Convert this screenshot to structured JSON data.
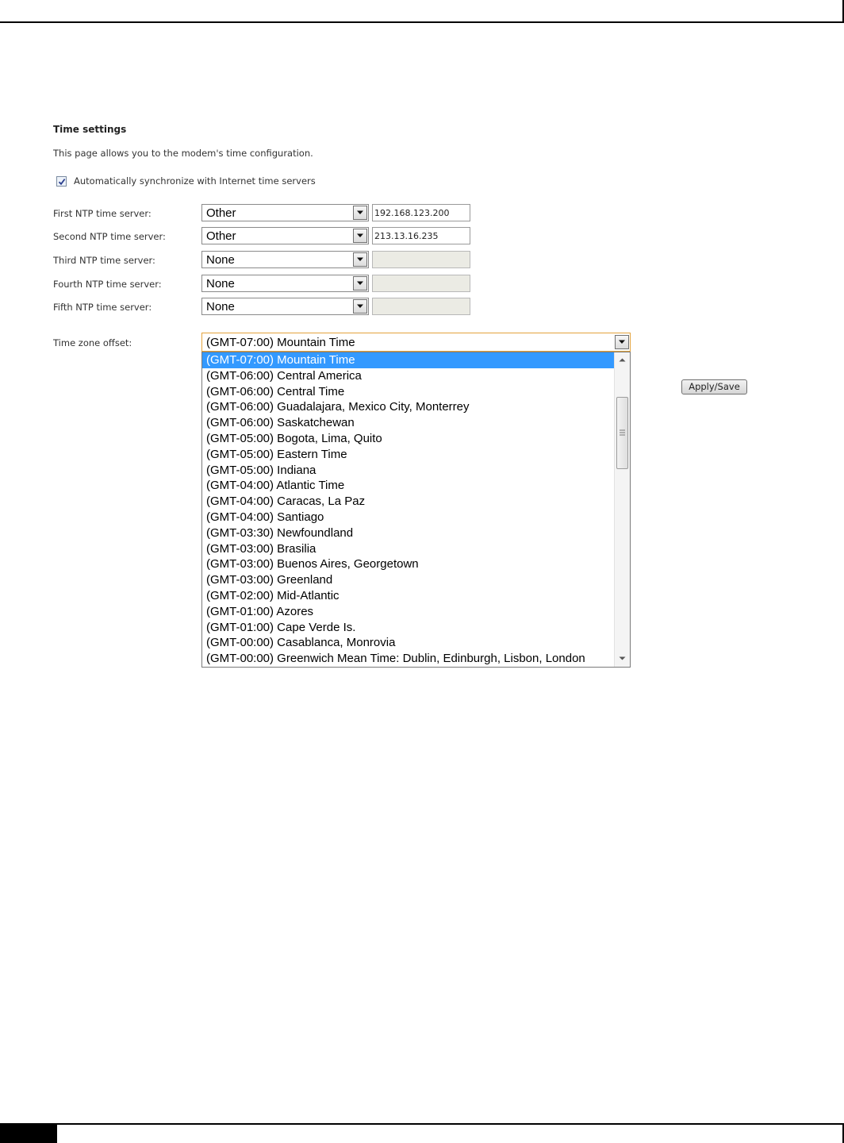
{
  "page": {
    "title": "Time settings",
    "description": "This page allows you to the modem's time configuration.",
    "sync": {
      "checked": true,
      "label": "Automatically synchronize with Internet time servers"
    },
    "ntp_servers": [
      {
        "label": "First NTP time server:",
        "selected": "Other",
        "value": "192.168.123.200",
        "disabled": false
      },
      {
        "label": "Second NTP time server:",
        "selected": "Other",
        "value": "213.13.16.235",
        "disabled": false
      },
      {
        "label": "Third NTP time server:",
        "selected": "None",
        "value": "",
        "disabled": true
      },
      {
        "label": "Fourth NTP time server:",
        "selected": "None",
        "value": "",
        "disabled": true
      },
      {
        "label": "Fifth NTP time server:",
        "selected": "None",
        "value": "",
        "disabled": true
      }
    ],
    "timezone": {
      "label": "Time zone offset:",
      "selected": "(GMT-07:00) Mountain Time",
      "options": [
        "(GMT-07:00) Mountain Time",
        "(GMT-06:00) Central America",
        "(GMT-06:00) Central Time",
        "(GMT-06:00) Guadalajara, Mexico City, Monterrey",
        "(GMT-06:00) Saskatchewan",
        "(GMT-05:00) Bogota, Lima, Quito",
        "(GMT-05:00) Eastern Time",
        "(GMT-05:00) Indiana",
        "(GMT-04:00) Atlantic Time",
        "(GMT-04:00) Caracas, La Paz",
        "(GMT-04:00) Santiago",
        "(GMT-03:30) Newfoundland",
        "(GMT-03:00) Brasilia",
        "(GMT-03:00) Buenos Aires, Georgetown",
        "(GMT-03:00) Greenland",
        "(GMT-02:00) Mid-Atlantic",
        "(GMT-01:00) Azores",
        "(GMT-01:00) Cape Verde Is.",
        "(GMT-00:00) Casablanca, Monrovia",
        "(GMT-00:00) Greenwich Mean Time: Dublin, Edinburgh, Lisbon, London"
      ]
    },
    "apply_label": "Apply/Save"
  },
  "colors": {
    "selection": "#3399ff",
    "focus_border": "#e4a33c",
    "disabled_field": "#ebebe4"
  },
  "icons": {
    "dropdown": "chevron-down-icon",
    "checkbox_mark": "check-icon",
    "scroll_up": "arrow-up-icon",
    "scroll_down": "arrow-down-icon"
  }
}
